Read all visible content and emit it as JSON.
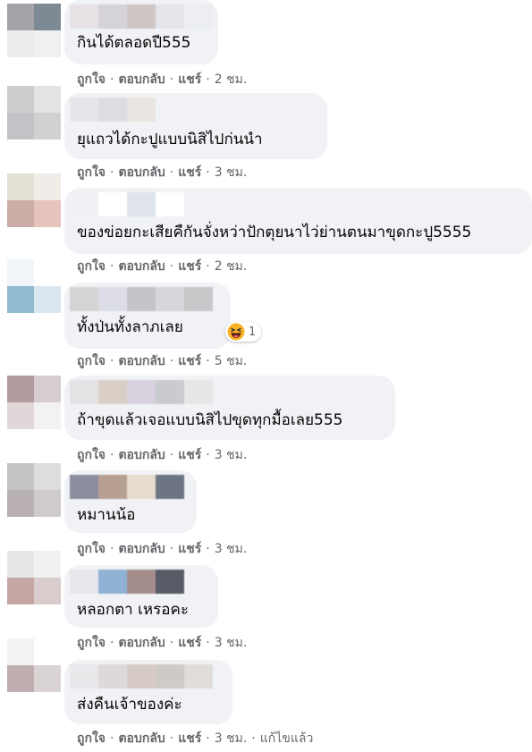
{
  "actions": {
    "like": "ถูกใจ",
    "reply": "ตอบกลับ",
    "share": "แชร์",
    "separator": "·",
    "edited": "แก้ไขแล้ว"
  },
  "comments": [
    {
      "text": "กินได้ตลอดปี555",
      "time": "2 ชม.",
      "avatar_colors": [
        "#a6a3a8",
        "#7d8a94",
        "#ececec",
        "#f0f0f0"
      ],
      "name_blur_colors": [
        "#e6e2e6",
        "#d5d2d9",
        "#cfc6c5",
        "#e3e5ea",
        "#eceef2"
      ]
    },
    {
      "text": "ยุแถวได้กะปูแบบนิสิไปก่นนำ",
      "time": "3 ชม.",
      "avatar_colors": [
        "#cfcccf",
        "#e3e3e6",
        "#c2c3c6",
        "#d3d0d1"
      ],
      "name_blur_colors": [
        "#e6e7ea",
        "#dcdde0",
        "#e9e6e2"
      ]
    },
    {
      "text": "ของข่อยกะเสียคืกันจั่งหว่าปักตุยนาไว่ย่านตนมาขุดกะปู5555",
      "time": "2 ชม.",
      "avatar_colors": [
        "#e5e0d5",
        "#f0ece7",
        "#c9ada6",
        "#e6c3bd"
      ],
      "name_blur_colors": [
        "#f0f1f4",
        "#ffffff",
        "#dfe4eb",
        "#ffffff"
      ]
    },
    {
      "text": "ทั้งป่นทั้งลาภเลย",
      "time": "5 ชม.",
      "avatar_colors": [
        "#f2f6f9",
        "#ffffff",
        "#91bad0",
        "#d9e6ef"
      ],
      "name_blur_colors": [
        "#d5d3d4",
        "#dcdde6",
        "#c6c4c9",
        "#d8d6da",
        "#c8c7c9"
      ],
      "reaction": {
        "emoji": "laugh-emoji",
        "count": "1"
      }
    },
    {
      "text": "ถ้าขุดแล้วเจอแบบนิสิไปขุดทุกมื้อเลย555",
      "time": "3 ชม.",
      "avatar_colors": [
        "#b39c9f",
        "#d7cdd0",
        "#e1d6d8",
        "#f3f1f1"
      ],
      "name_blur_colors": [
        "#e3e2e5",
        "#d9cfc6",
        "#d8d2de",
        "#c9cbcf",
        "#e7e6e6"
      ]
    },
    {
      "text": "หมานน้อ",
      "time": "3 ชม.",
      "avatar_colors": [
        "#c6c3c5",
        "#dddcde",
        "#b8b0b3",
        "#cfcbcd"
      ],
      "name_blur_colors": [
        "#8c8ea0",
        "#b79f92",
        "#e7dccd",
        "#6d7582"
      ]
    },
    {
      "text": "หลอกตา เหรอคะ",
      "time": "3 ชม.",
      "avatar_colors": [
        "#e8e7e8",
        "#f2f1f1",
        "#c4a7a3",
        "#d9cccc"
      ],
      "name_blur_colors": [
        "#e6e8ec",
        "#8fb2d4",
        "#a58d8c",
        "#585a66"
      ]
    },
    {
      "text": "ส่งคืนเจ้าของค่ะ",
      "time": "3 ชม.",
      "avatar_colors": [
        "#f2f2f2",
        "#ffffff",
        "#c1aeb1",
        "#d9d3d4"
      ],
      "name_blur_colors": [
        "#e9e9ec",
        "#ddd8db",
        "#d6cbc4",
        "#cecbc7",
        "#e0dcda"
      ],
      "edited": true
    }
  ]
}
